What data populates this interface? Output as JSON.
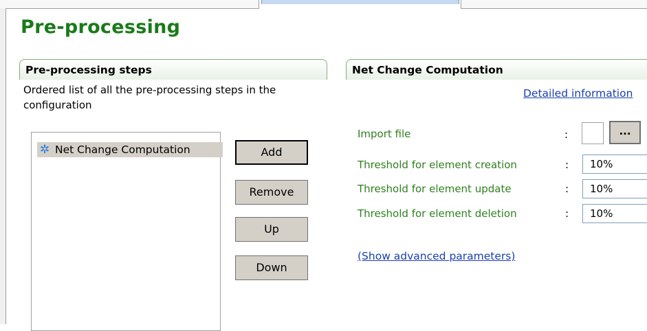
{
  "page_title": "Pre-processing",
  "steps_section": {
    "header": "Pre-processing steps",
    "description": "Ordered list of all the pre-processing steps in the configuration",
    "items": [
      "Net Change Computation"
    ],
    "buttons": {
      "add": "Add",
      "remove": "Remove",
      "up": "Up",
      "down": "Down"
    }
  },
  "detail_section": {
    "header": "Net Change Computation",
    "detailed_link": "Detailed information",
    "params": [
      {
        "label": "Import file",
        "colon": ":",
        "value": "",
        "browse_label": "..."
      },
      {
        "label": "Threshold for element creation",
        "colon": ":",
        "value": "10%"
      },
      {
        "label": "Threshold for element update",
        "colon": ":",
        "value": "10%"
      },
      {
        "label": "Threshold for element deletion",
        "colon": ":",
        "value": "10%"
      }
    ],
    "advanced_link": "(Show advanced parameters)"
  },
  "colors": {
    "title_green": "#1a7a1a",
    "label_green": "#2f7f1f",
    "link_blue": "#1a3fae",
    "selection_gray": "#d4d0c8"
  },
  "icons": {
    "step_icon": "gear-icon"
  }
}
